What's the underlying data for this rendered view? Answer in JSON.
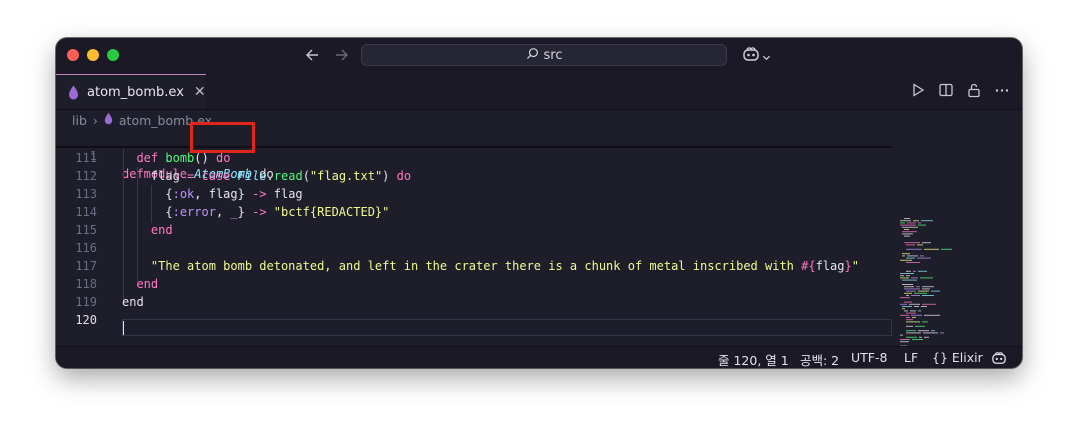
{
  "window": {
    "search_text": "src"
  },
  "tab": {
    "label": "atom_bomb.ex",
    "close_glyph": "✕"
  },
  "breadcrumb": {
    "folder": "lib",
    "separator": "›",
    "file": "atom_bomb.ex"
  },
  "editor": {
    "sticky": {
      "line_number": "1",
      "keyword": "defmodule",
      "module": "AtomBomb",
      "do": "do"
    },
    "lines": [
      {
        "n": "111",
        "indent": "  ",
        "tokens": [
          [
            "kw",
            "def"
          ],
          [
            "plain",
            " "
          ],
          [
            "fn",
            "bomb"
          ],
          [
            "plain",
            "() "
          ],
          [
            "kw",
            "do"
          ]
        ]
      },
      {
        "n": "112",
        "indent": "    ",
        "tokens": [
          [
            "plain",
            "flag "
          ],
          [
            "op",
            "="
          ],
          [
            "plain",
            " "
          ],
          [
            "kw",
            "case"
          ],
          [
            "plain",
            " "
          ],
          [
            "mod",
            "File"
          ],
          [
            "plain",
            "."
          ],
          [
            "fn",
            "read"
          ],
          [
            "plain",
            "("
          ],
          [
            "str",
            "\"flag.txt\""
          ],
          [
            "plain",
            ") "
          ],
          [
            "kw",
            "do"
          ]
        ]
      },
      {
        "n": "113",
        "indent": "      ",
        "tokens": [
          [
            "plain",
            "{"
          ],
          [
            "atom",
            ":ok"
          ],
          [
            "plain",
            ", flag} "
          ],
          [
            "op",
            "->"
          ],
          [
            "plain",
            " flag"
          ]
        ]
      },
      {
        "n": "114",
        "indent": "      ",
        "tokens": [
          [
            "plain",
            "{"
          ],
          [
            "atom",
            ":error"
          ],
          [
            "plain",
            ", "
          ],
          [
            "atom",
            "_"
          ],
          [
            "plain",
            "} "
          ],
          [
            "op",
            "->"
          ],
          [
            "plain",
            " "
          ],
          [
            "str",
            "\"bctf{REDACTED}\""
          ]
        ]
      },
      {
        "n": "115",
        "indent": "    ",
        "tokens": [
          [
            "kw",
            "end"
          ]
        ]
      },
      {
        "n": "116",
        "indent": "",
        "tokens": []
      },
      {
        "n": "117",
        "indent": "    ",
        "tokens": [
          [
            "str",
            "\"The atom bomb detonated, and left in the crater there is a chunk of metal inscribed with "
          ],
          [
            "op",
            "#{"
          ],
          [
            "plain",
            "flag"
          ],
          [
            "op",
            "}"
          ],
          [
            "str",
            "\""
          ]
        ]
      },
      {
        "n": "118",
        "indent": "  ",
        "tokens": [
          [
            "kw",
            "end"
          ]
        ]
      },
      {
        "n": "119",
        "indent": "",
        "tokens": [
          [
            "plain",
            "end"
          ]
        ]
      },
      {
        "n": "120",
        "indent": "",
        "tokens": []
      }
    ]
  },
  "statusbar": {
    "position": "줄 120, 열 1",
    "spaces": "공백: 2",
    "encoding": "UTF-8",
    "eol": "LF",
    "language_icon": "{}",
    "language": "Elixir"
  },
  "colors": {
    "accent_elixir": "#9b6bd3",
    "highlight_box": "#e0261b"
  }
}
